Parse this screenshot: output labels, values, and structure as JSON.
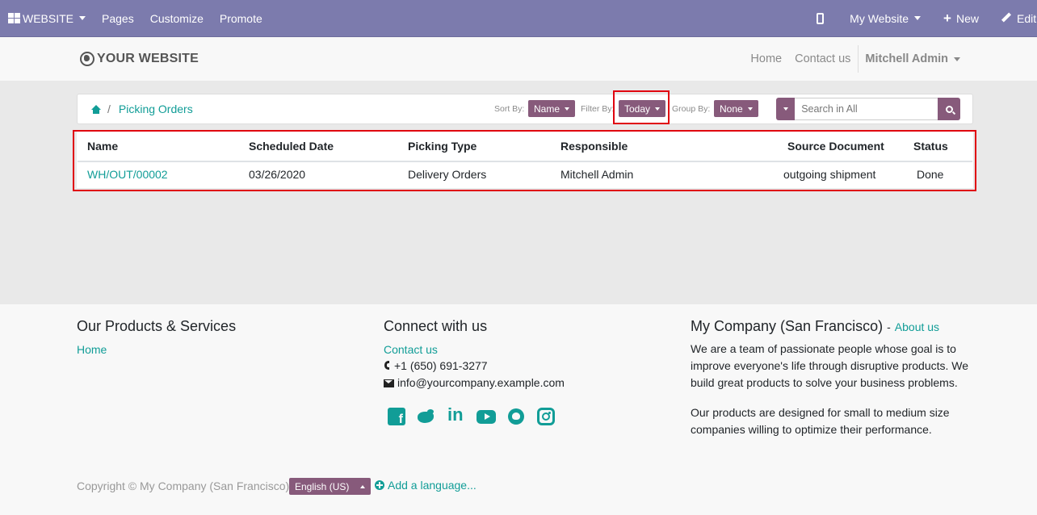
{
  "topbar": {
    "website_menu": "WEBSITE",
    "pages": "Pages",
    "customize": "Customize",
    "promote": "Promote",
    "site_switcher": "My Website",
    "new_label": "New",
    "edit_label": "Edit"
  },
  "navbar": {
    "brand": "YOUR WEBSITE",
    "links": [
      "Home",
      "Contact us"
    ],
    "user": "Mitchell Admin"
  },
  "breadcrumb": {
    "current": "Picking Orders",
    "separator": "/"
  },
  "controls": {
    "sort_label": "Sort By:",
    "sort_value": "Name",
    "filter_label": "Filter By:",
    "filter_value": "Today",
    "group_label": "Group By:",
    "group_value": "None",
    "search_placeholder": "Search in All"
  },
  "table": {
    "headers": [
      "Name",
      "Scheduled Date",
      "Picking Type",
      "Responsible",
      "Source Document",
      "Status"
    ],
    "rows": [
      [
        "WH/OUT/00002",
        "03/26/2020",
        "Delivery Orders",
        "Mitchell Admin",
        "outgoing shipment",
        "Done"
      ]
    ]
  },
  "footer": {
    "col1_title": "Our Products & Services",
    "col1_link": "Home",
    "col2_title": "Connect with us",
    "col2_link": "Contact us",
    "phone": "+1 (650) 691-3277",
    "email": "info@yourcompany.example.com",
    "col3_title": "My Company (San Francisco)",
    "col3_dash": "-",
    "col3_link": "About us",
    "about_p1_lines": [
      "We are a team of passionate people whose goal is to",
      "improve everyone's life through disruptive products. We",
      "build great products to solve your business problems."
    ],
    "about_p2_lines": [
      "Our products are designed for small to medium size",
      "companies willing to optimize their performance."
    ],
    "social_icons": [
      "facebook-icon",
      "twitter-icon",
      "linkedin-icon",
      "youtube-icon",
      "github-icon",
      "instagram-icon"
    ],
    "copyright": "Copyright © My Company (San Francisco)",
    "language": "English (US)",
    "add_language": "Add a language..."
  },
  "colors": {
    "topbar": "#7c7bad",
    "accent": "#875a7b",
    "link": "#119d97",
    "highlight": "#e0000f"
  }
}
